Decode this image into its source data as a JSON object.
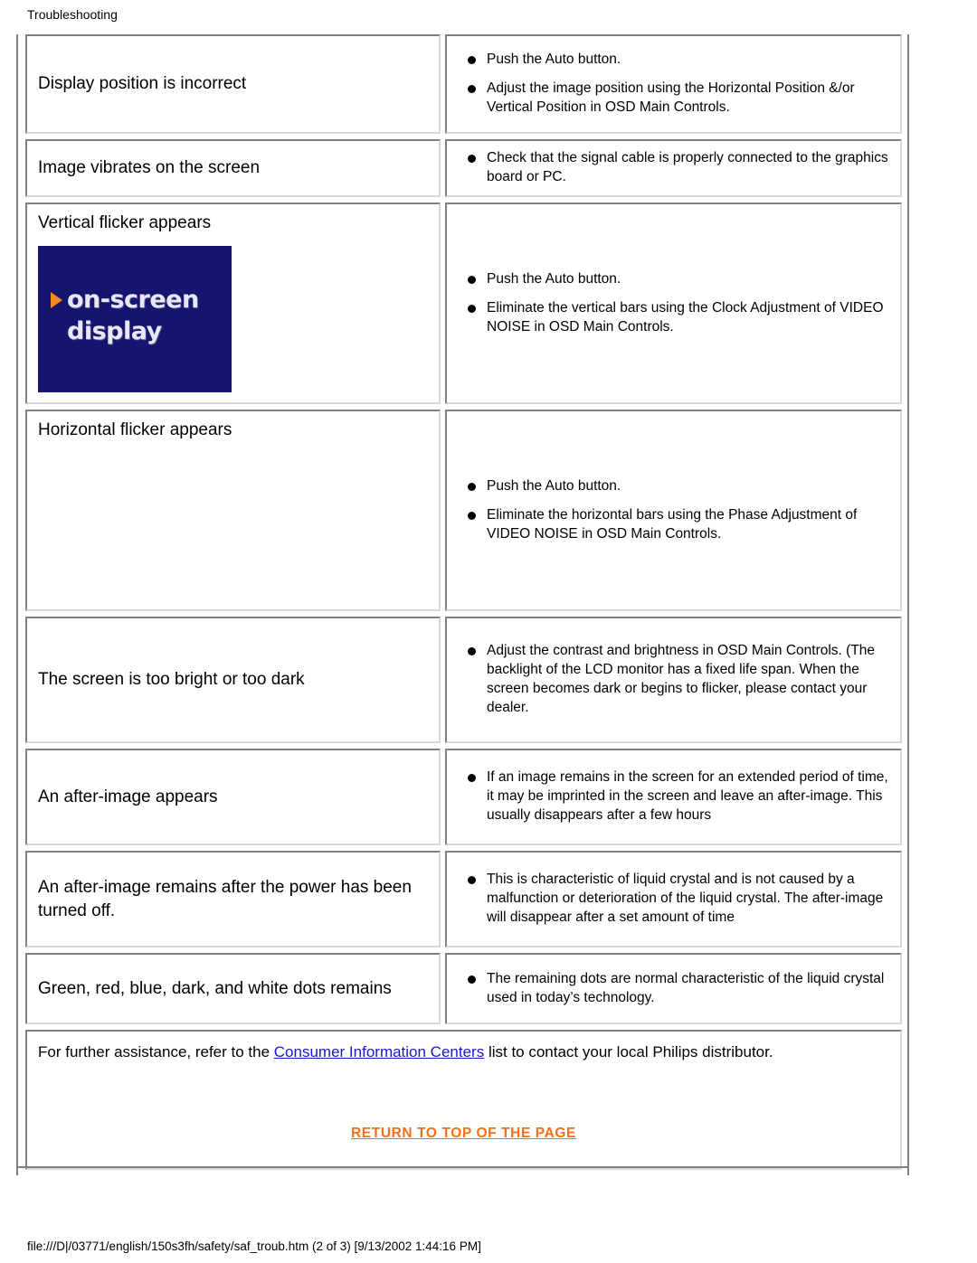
{
  "header": {
    "title": "Troubleshooting"
  },
  "table": {
    "rows": [
      {
        "symptom": "Display position is incorrect",
        "bullets": [
          "Push the Auto button.",
          "Adjust the image position using the Horizontal Position &/or Vertical Position in OSD Main Controls."
        ],
        "left_height": 110,
        "right_height": 110,
        "symptom_top_align": false,
        "has_image": false
      },
      {
        "symptom": "Image vibrates on the screen",
        "bullets": [
          "Check that the signal cable is properly connected to the graphics board or PC."
        ],
        "left_height": 54,
        "right_height": 54,
        "symptom_top_align": false,
        "has_image": false
      },
      {
        "symptom": "Vertical flicker appears",
        "bullets": [
          "Push the Auto button.",
          "Eliminate the vertical bars using the Clock Adjustment of VIDEO NOISE in OSD Main Controls."
        ],
        "left_height": 223,
        "right_height": 223,
        "symptom_top_align": true,
        "has_image": true
      },
      {
        "symptom": "Horizontal flicker appears",
        "bullets": [
          "Push the Auto button.",
          "Eliminate the horizontal bars using the Phase Adjustment of VIDEO NOISE in OSD Main Controls."
        ],
        "left_height": 223,
        "right_height": 223,
        "symptom_top_align": true,
        "has_image": false
      },
      {
        "symptom": "The screen is too bright or too dark",
        "bullets": [
          "Adjust the contrast and brightness in OSD Main Controls. (The backlight of the LCD monitor has a fixed life span. When the screen becomes dark or begins to flicker, please contact your dealer."
        ],
        "left_height": 140,
        "right_height": 140,
        "symptom_top_align": false,
        "has_image": false
      },
      {
        "symptom": "An after-image appears",
        "bullets": [
          "If an image remains in the screen for an extended period of time, it may be imprinted in the screen and leave an after-image. This usually disappears after a few hours"
        ],
        "left_height": 107,
        "right_height": 107,
        "symptom_top_align": false,
        "has_image": false
      },
      {
        "symptom": "An after-image remains after the power has been turned off.",
        "bullets": [
          "This is characteristic of liquid crystal and is not caused by a malfunction or deterioration of the liquid crystal. The after-image will disappear after a set amount of time"
        ],
        "left_height": 107,
        "right_height": 107,
        "symptom_top_align": false,
        "has_image": false
      },
      {
        "symptom": "Green, red, blue, dark, and white dots remains",
        "bullets": [
          "The remaining dots are normal characteristic of the liquid crystal used in today’s technology."
        ],
        "left_height": 79,
        "right_height": 79,
        "symptom_top_align": false,
        "has_image": false
      }
    ]
  },
  "osd_image": {
    "line1": "on-screen",
    "line2": "display",
    "background_color": "#151570",
    "text_color": "#e8e8f4",
    "marker_color": "#f08a1c"
  },
  "footer": {
    "text_before_link": "For further assistance, refer to the ",
    "link_label": "Consumer Information Centers",
    "text_after_link": " list to contact your local Philips distributor.",
    "return_link_label": "RETURN TO TOP OF THE PAGE",
    "link_color": "#1818c8",
    "return_link_color": "#f4701a"
  },
  "status_bar": {
    "text": "file:///D|/03771/english/150s3fh/safety/saf_troub.htm (2 of 3) [9/13/2002 1:44:16 PM]"
  }
}
